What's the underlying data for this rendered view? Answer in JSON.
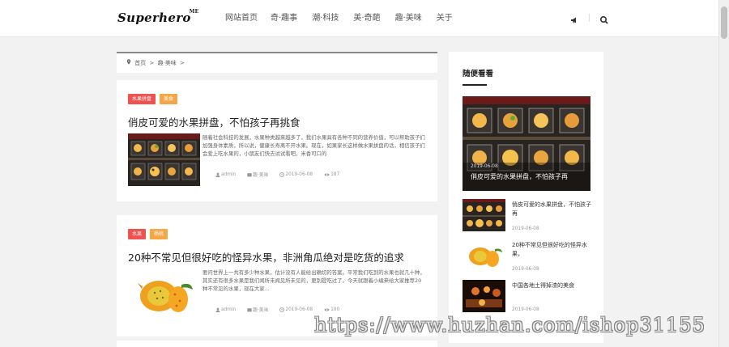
{
  "header": {
    "logo": "Superhero",
    "logo_sup": "ME",
    "nav": [
      "网站首页",
      "奇·趣事",
      "潮·科技",
      "美·奇葩",
      "趣·美味",
      "关于"
    ]
  },
  "breadcrumb": {
    "home": "首页",
    "sep1": ">",
    "section": "趣·美味",
    "sep2": ">"
  },
  "posts": [
    {
      "tags": [
        "水果拼盘",
        "美食"
      ],
      "title": "俏皮可爱的水果拼盘，不怕孩子再挑食",
      "excerpt": "随着社会科技的发展，水果种类越来越多了，我们水果具有各种不同的营养价值，可以帮助孩子们加强身体素质，所以说，健康长寿离不开水果。现在，如果家长这样做水果拼盘的话，相信孩子们会爱上吃水果的，小朋友们快去试试看吧，米香可口的",
      "author": "admin",
      "category": "趣·美味",
      "date": "2019-06-08",
      "views": "187"
    },
    {
      "tags": [
        "水果",
        "杨桃"
      ],
      "title": "20种不常见但很好吃的怪异水果，非洲角瓜绝对是吃货的追求",
      "excerpt": "要问世界上一共有多少种水果，估计没有人能给出确切的答案。平常我们吃到的水果也就几十种，其实还有很多水果是我们闻所未闻见所未见的，更别提吃过了。今天就跟着小编来给大家推荐20种不常见的水果，现在大家...",
      "author": "admin",
      "category": "趣·美味",
      "date": "2019-06-08",
      "views": "100"
    }
  ],
  "sidebar": {
    "title": "随便看看",
    "featured": {
      "date": "2019-06-08",
      "title": "俏皮可爱的水果拼盘，不怕孩子再"
    },
    "items": [
      {
        "title": "俏皮可爱的水果拼盘，不怕孩子再",
        "date": "2019-06-08"
      },
      {
        "title": "20种不常见但很好吃的怪异水果，",
        "date": "2019-06-08"
      },
      {
        "title": "中国各地土得掉渣的美食",
        "date": "2019-06-08"
      }
    ]
  },
  "watermark": "https://www.huzhan.com/ishop31155",
  "colors": {
    "tag_red": "#ef5350",
    "tag_orange": "#f6a645"
  }
}
